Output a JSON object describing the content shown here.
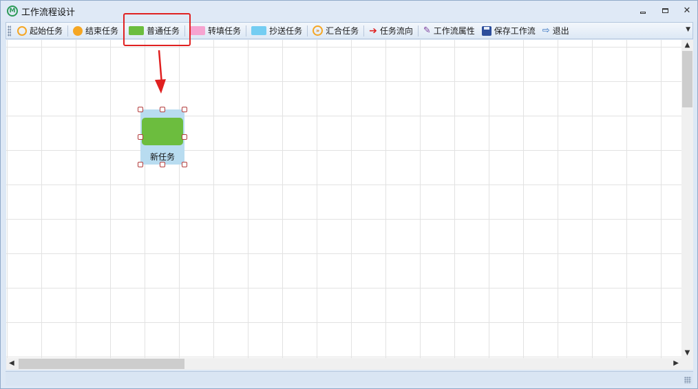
{
  "window": {
    "title": "工作流程设计",
    "logo_letter": "M",
    "controls": {
      "minimize": "minimize",
      "maximize": "maximize",
      "close": "✕"
    }
  },
  "toolbar": {
    "start_task": "起始任务",
    "end_task": "结束任务",
    "normal_task": "普通任务",
    "fill_task": "转填任务",
    "copy_task": "抄送任务",
    "merge_task": "汇合任务",
    "task_flow": "任务流向",
    "workflow_props": "工作流属性",
    "save_workflow": "保存工作流",
    "exit": "退出",
    "overflow_glyph": "▼"
  },
  "canvas": {
    "node": {
      "label": "新任务"
    }
  },
  "scrollbars": {
    "up": "▲",
    "down": "▼",
    "left": "◀",
    "right": "▶"
  },
  "colors": {
    "start_icon": "#f5a623",
    "end_icon": "#f5a623",
    "normal_task": "#6cbd3e",
    "fill_task": "#f6a4d0",
    "copy_task": "#74cdf2",
    "node_background": "#b8dcf0",
    "highlight": "#e02020"
  }
}
